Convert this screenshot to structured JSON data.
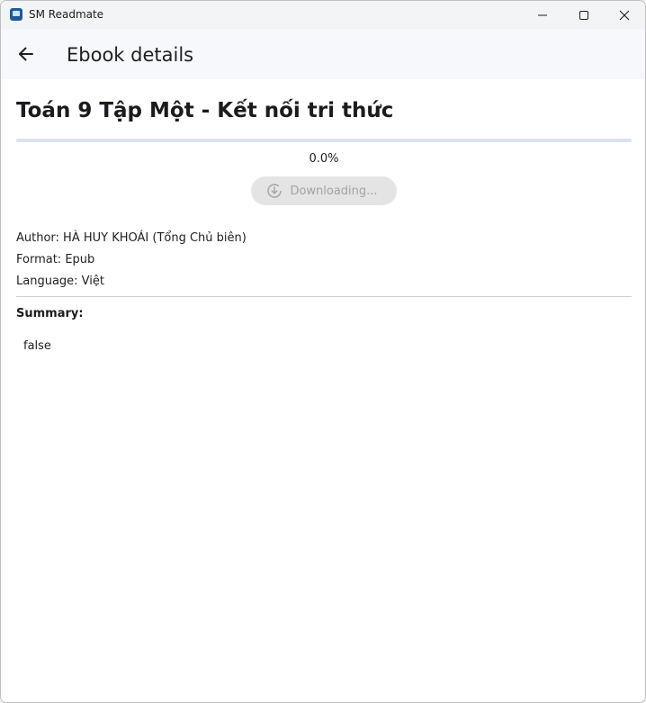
{
  "window": {
    "app_title": "SM Readmate"
  },
  "appbar": {
    "title": "Ebook details"
  },
  "book": {
    "title": "Toán 9 Tập Một - Kết nối tri thức",
    "download_progress_percent": 0.0,
    "progress_text": "0.0%",
    "download_button_label": "Downloading...",
    "author_line": "Author: HÀ HUY KHOÁI (Tổng Chủ biên)",
    "format_line": "Format: Epub",
    "language_line": "Language: Việt",
    "summary_label": "Summary:",
    "summary_text": "false"
  },
  "icons": {
    "back": "arrow-left-icon",
    "download": "download-circle-icon",
    "minimize": "minimize-icon",
    "maximize": "maximize-icon",
    "close": "close-icon"
  },
  "colors": {
    "accent": "#3a6ea5",
    "progress_track": "#d8e3f2",
    "appbar_background": "#f6f8fc",
    "disabled_button_bg": "#e4e4e5",
    "disabled_button_text": "#a3a3a5"
  }
}
